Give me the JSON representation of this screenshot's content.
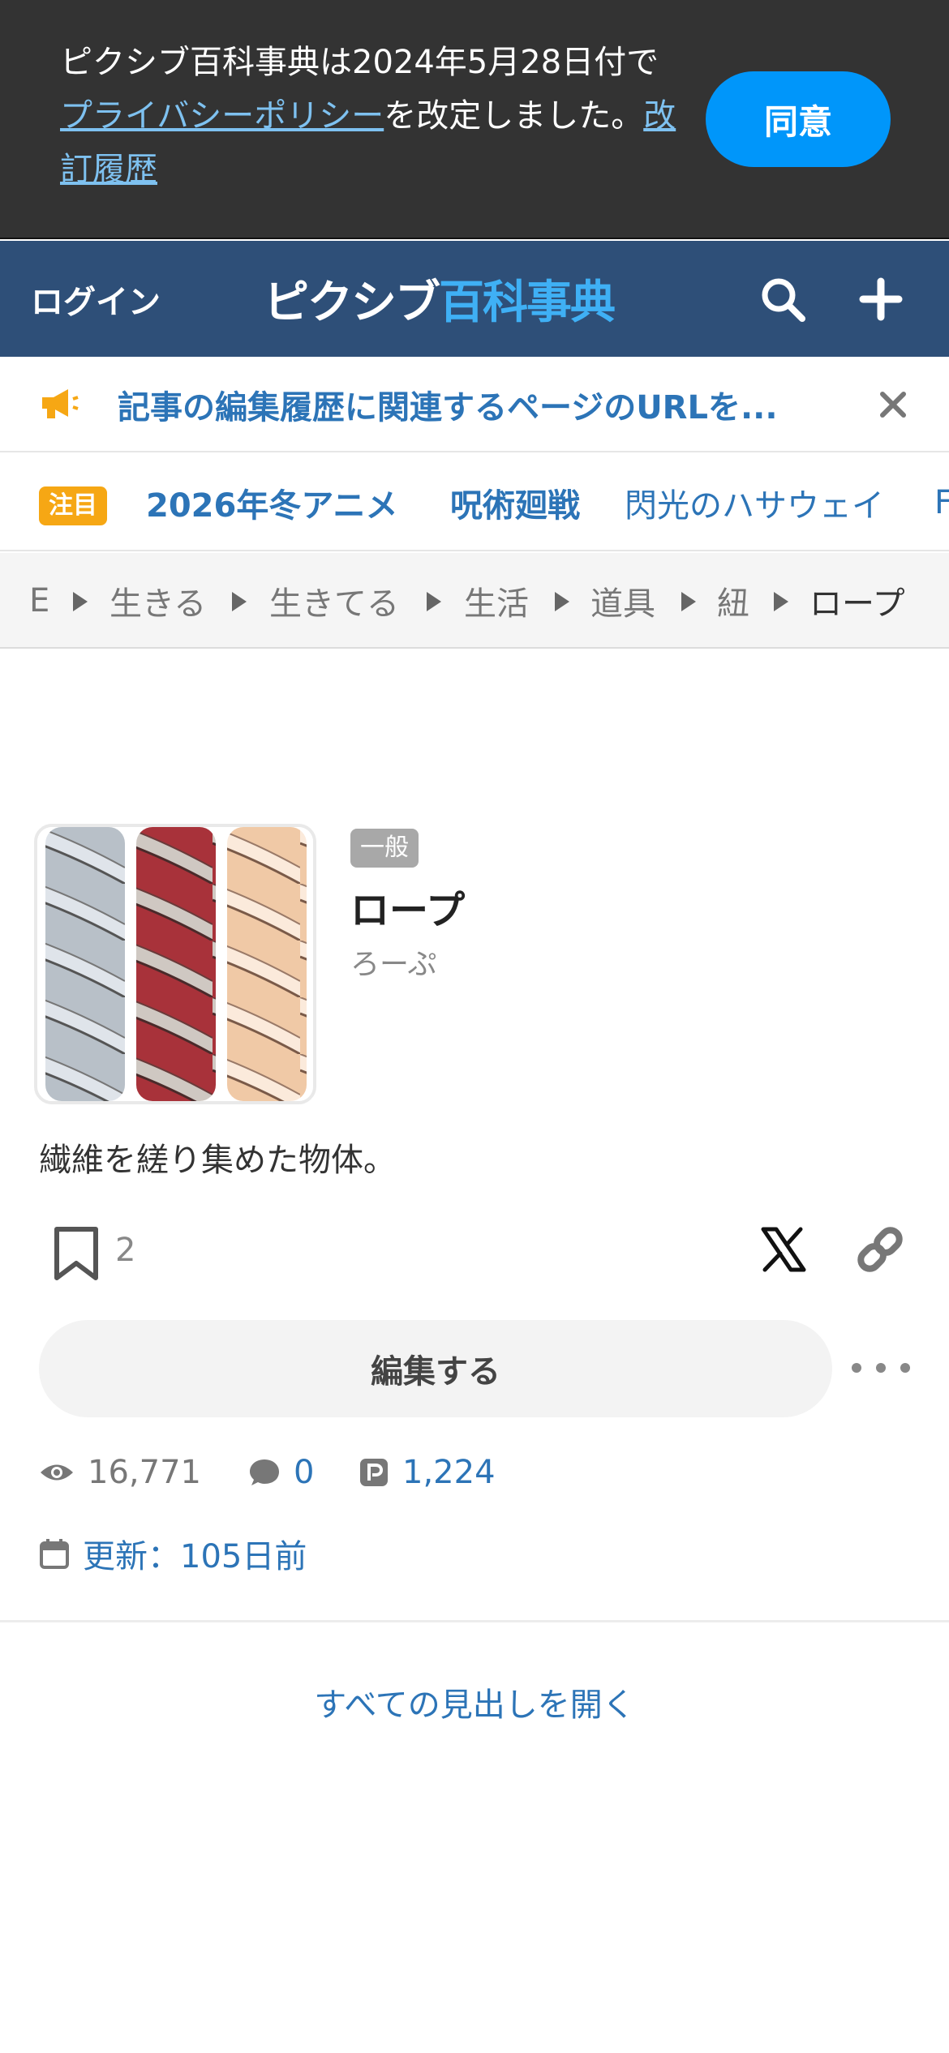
{
  "privacy_banner": {
    "text_before": "ピクシブ百科事典は2024年5月28日付で",
    "policy_link": "プライバシーポリシー",
    "text_after": "を改定しました。",
    "history_link": "改訂履歴",
    "agree_label": "同意"
  },
  "header": {
    "login_label": "ログイン",
    "logo_part1": "ピクシブ",
    "logo_part2": "百科事典",
    "icons": [
      "search-icon",
      "plus-icon"
    ]
  },
  "notice": {
    "text": "記事の編集履歴に関連するページのURLを...",
    "icon": "megaphone-icon",
    "close_icon": "close-icon",
    "accent": "#f6a714"
  },
  "trending": {
    "badge": "注目",
    "items": [
      "2026年冬アニメ",
      "呪術廻戦",
      "閃光のハサウェイ",
      "F"
    ]
  },
  "breadcrumb": {
    "items": [
      "E",
      "生きる",
      "生きてる",
      "生活",
      "道具",
      "紐",
      "ロープ"
    ]
  },
  "article": {
    "category": "一般",
    "title": "ロープ",
    "reading": "ろーぷ",
    "description": "繊維を縒り集めた物体。",
    "bookmark_count": "2",
    "edit_label": "編集する",
    "views": "16,771",
    "comments": "0",
    "points": "1,224",
    "updated": "更新：105日前"
  },
  "expand_all_label": "すべての見出しを開く",
  "colors": {
    "header_bg": "#2e4f78",
    "link": "#2c74b7",
    "agree_button": "#0096fa",
    "logo_accent": "#3fb0f5"
  }
}
